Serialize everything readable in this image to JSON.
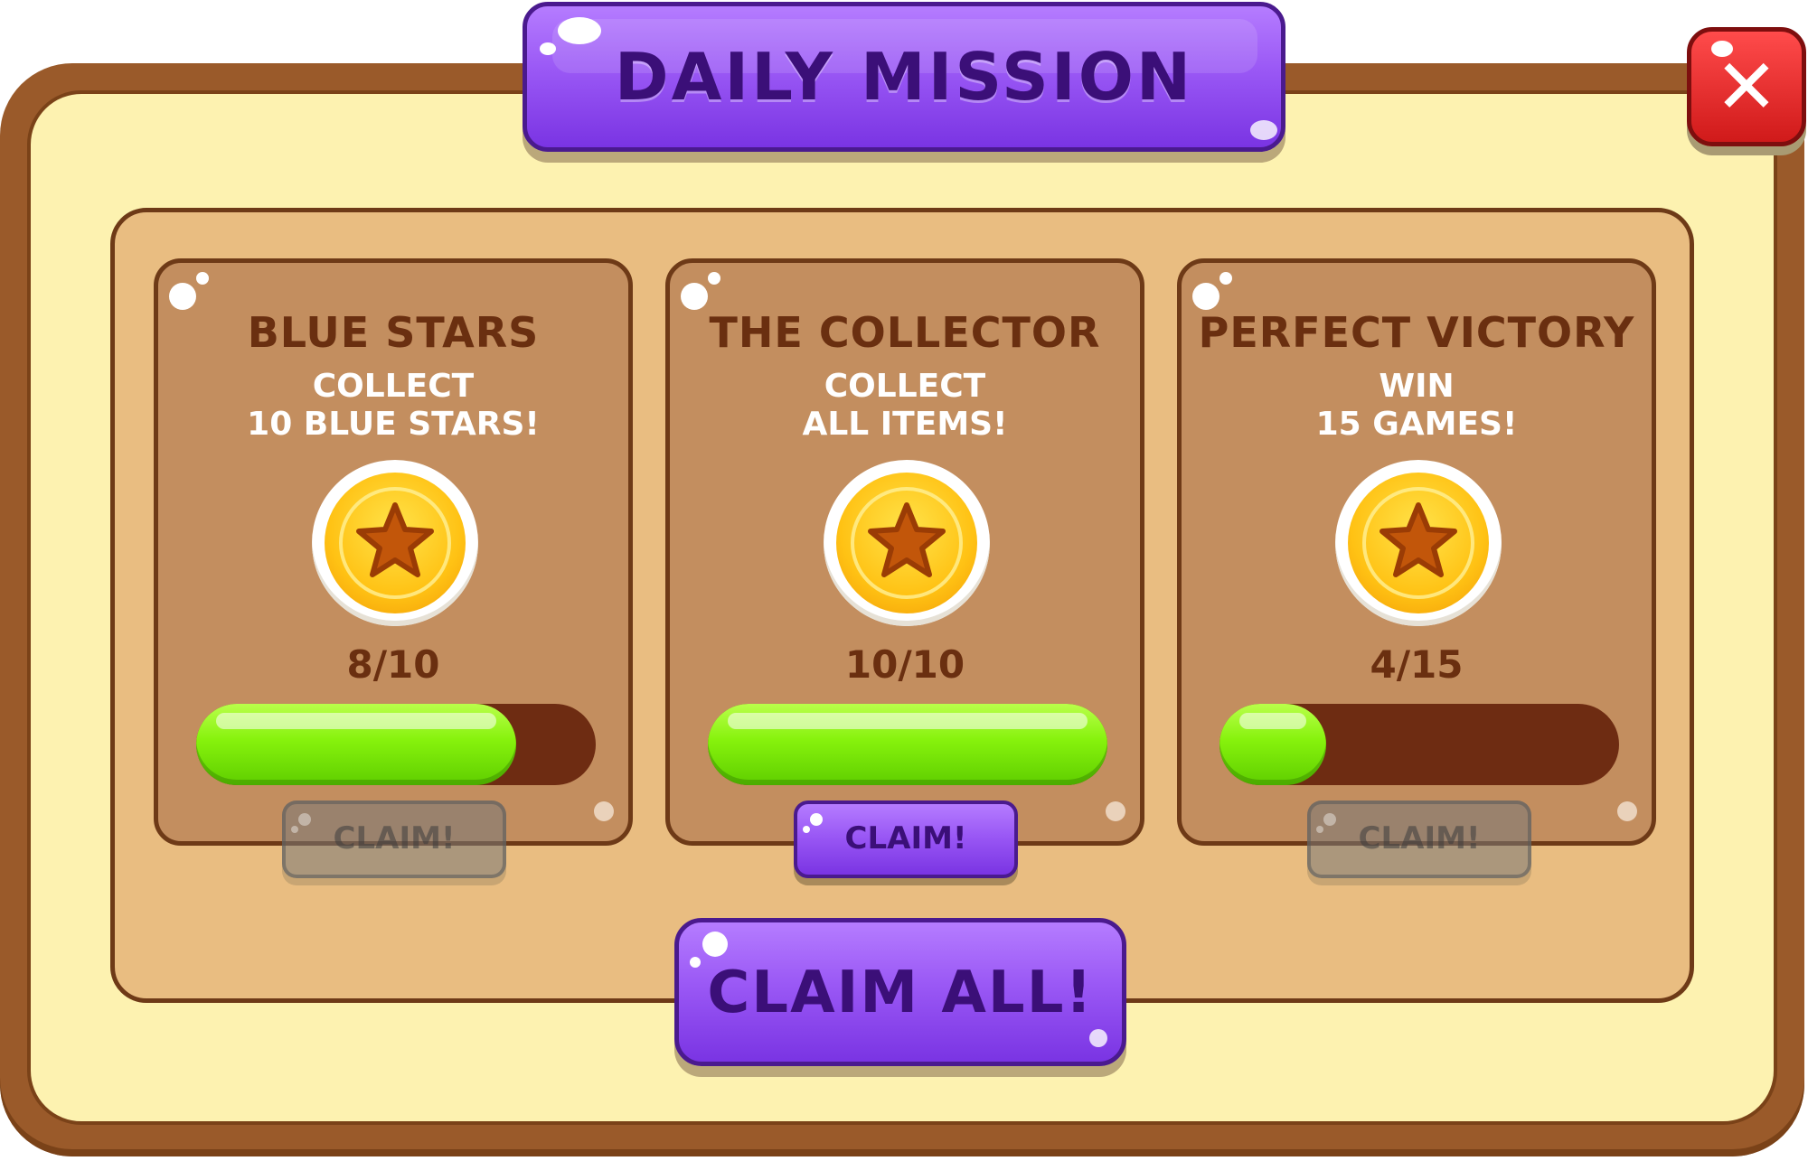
{
  "header": {
    "title": "DAILY MISSION"
  },
  "close_button": {
    "symbol": "✕",
    "icon": "close-icon"
  },
  "missions": [
    {
      "title": "BLUE STARS",
      "description_line1": "COLLECT",
      "description_line2": "10 BLUE STARS!",
      "progress_label": "8/10",
      "progress_fraction": 0.8,
      "reward_icon": "star-coin-icon",
      "claim_label": "CLAIM!",
      "claim_enabled": false
    },
    {
      "title": "THE COLLECTOR",
      "description_line1": "COLLECT",
      "description_line2": "ALL ITEMS!",
      "progress_label": "10/10",
      "progress_fraction": 1.0,
      "reward_icon": "star-coin-icon",
      "claim_label": "CLAIM!",
      "claim_enabled": true
    },
    {
      "title": "PERFECT VICTORY",
      "description_line1": "WIN",
      "description_line2": "15 GAMES!",
      "progress_label": "4/15",
      "progress_fraction": 0.267,
      "reward_icon": "star-coin-icon",
      "claim_label": "CLAIM!",
      "claim_enabled": false
    }
  ],
  "claim_all_button": {
    "label": "CLAIM ALL!"
  },
  "colors": {
    "frame_brown": "#9a5a2a",
    "panel_cream": "#fdf2b0",
    "content_tan": "#e9bd81",
    "card_brown": "#c38e5f",
    "button_purple": "#9a58f5",
    "progress_green": "#86f20c",
    "close_red": "#e02424"
  }
}
